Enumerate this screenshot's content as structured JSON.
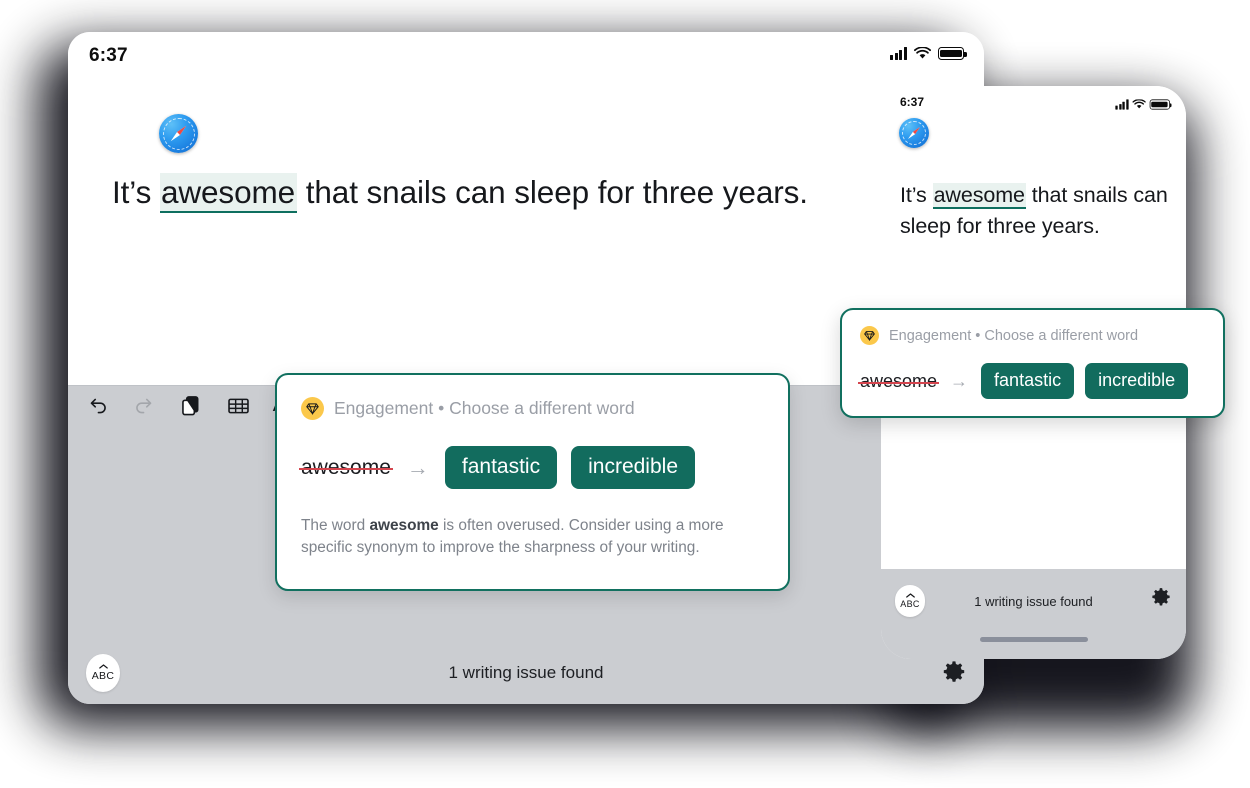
{
  "tablet": {
    "status": {
      "clock": "6:37",
      "signal_icon": "signal-bars-icon",
      "wifi_icon": "wifi-icon",
      "battery_icon": "battery-icon"
    },
    "app_icon": "safari-compass-icon",
    "document": {
      "text_before": "It’s ",
      "highlighted_word": "awesome",
      "text_after": " that snails can sleep for three years."
    },
    "toolbar": {
      "items": [
        {
          "name": "undo-icon",
          "label": "Undo",
          "disabled": false
        },
        {
          "name": "redo-icon",
          "label": "Redo",
          "disabled": true
        },
        {
          "name": "copy-icon",
          "label": "Copy",
          "disabled": false
        },
        {
          "name": "table-icon",
          "label": "Table",
          "disabled": false
        },
        {
          "name": "text-format-icon",
          "label": "Aa",
          "disabled": false
        }
      ]
    },
    "bottombar": {
      "keyboard_button_label": "ABC",
      "keyboard_button_icon": "chevron-up-icon",
      "status_text": "1 writing issue found",
      "settings_icon": "gear-icon"
    }
  },
  "suggestion_card": {
    "badge_icon": "gem-icon",
    "category": "Engagement",
    "separator": "•",
    "headline": "Choose a different word",
    "header_text": "Engagement • Choose a different word",
    "original_word": "awesome",
    "arrow": "→",
    "suggestions": [
      {
        "label": "fantastic"
      },
      {
        "label": "incredible"
      }
    ],
    "explanation_prefix": "The word ",
    "explanation_word": "awesome",
    "explanation_suffix": " is often overused. Consider using a more specific synonym to improve the sharpness of your writing."
  },
  "phone": {
    "status": {
      "clock": "6:37",
      "signal_icon": "signal-bars-icon",
      "wifi_icon": "wifi-icon",
      "battery_icon": "battery-icon"
    },
    "app_icon": "safari-compass-icon",
    "document": {
      "text_before": "It’s ",
      "highlighted_word": "awesome",
      "text_after": " that snails can sleep for three years."
    },
    "bottombar": {
      "keyboard_button_label": "ABC",
      "keyboard_button_icon": "chevron-up-icon",
      "status_text": "1 writing issue found",
      "settings_icon": "gear-icon"
    }
  },
  "colors": {
    "accent_teal": "#126c5e",
    "highlight_bg": "#e9f2ef",
    "badge_yellow": "#fbc84b",
    "strike_red": "#d4454e",
    "chrome_grey": "#cbcdd1"
  }
}
